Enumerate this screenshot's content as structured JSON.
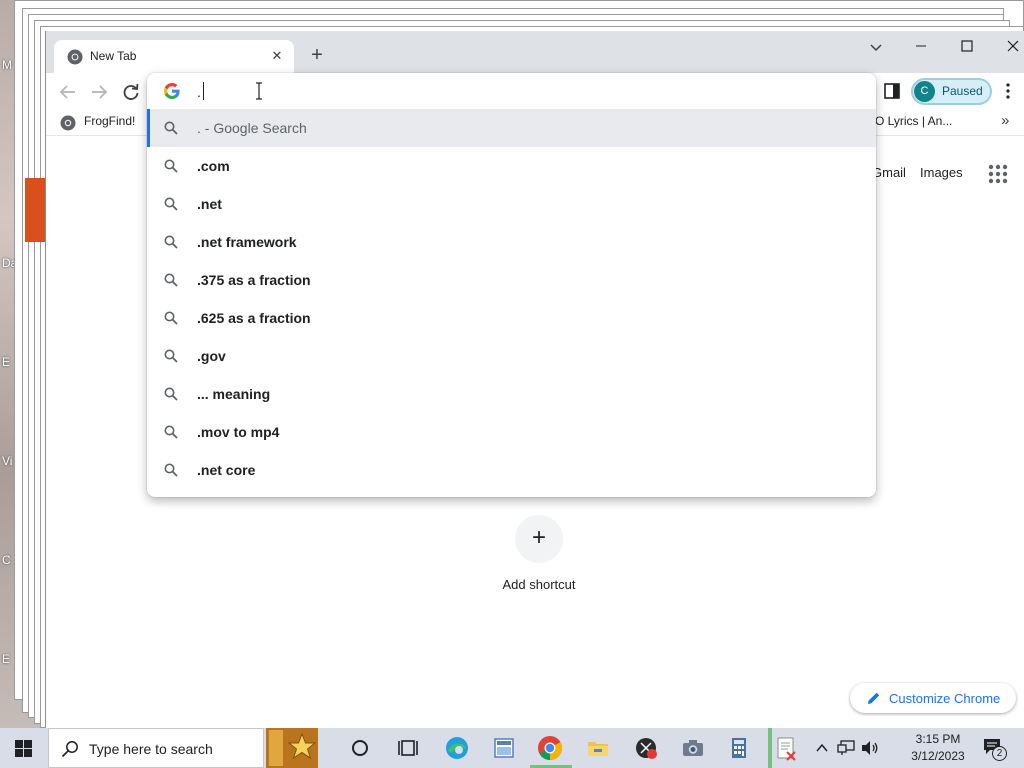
{
  "desktop": {
    "side_labels": [
      "M",
      "Da",
      "E",
      "Vi",
      "C",
      "E"
    ]
  },
  "browser": {
    "tab": {
      "title": "New Tab"
    },
    "profile": {
      "initial": "C",
      "status": "Paused"
    },
    "bookmarks": [
      {
        "label": "FrogFind!"
      },
      {
        "label": "O Lyrics | An..."
      }
    ],
    "ntp": {
      "gmail_link": "Gmail",
      "images_link": "Images",
      "add_shortcut_label": "Add shortcut",
      "customize_label": "Customize Chrome"
    }
  },
  "omnibox": {
    "input_value": ".",
    "suggestions": [
      {
        "text": ". - Google Search",
        "selected": true
      },
      {
        "text": ".com"
      },
      {
        "text": ".net"
      },
      {
        "text": ".net framework"
      },
      {
        "text": ".375 as a fraction"
      },
      {
        "text": ".625 as a fraction"
      },
      {
        "text": ".gov"
      },
      {
        "text": "... meaning"
      },
      {
        "text": ".mov to mp4"
      },
      {
        "text": ".net core"
      }
    ]
  },
  "taskbar": {
    "search_placeholder": "Type here to search",
    "time": "3:15 PM",
    "date": "3/12/2023",
    "notification_count": "2",
    "colors": {
      "active_indicator": "#79c07d",
      "taskbar_bg": "#d9dde7"
    }
  },
  "colors": {
    "accent": "#1a73e8",
    "tabstrip": "#dee1e6",
    "selected_row": "#e8eaed",
    "profile_bg": "#d6eef7",
    "avatar": "#12858c"
  }
}
